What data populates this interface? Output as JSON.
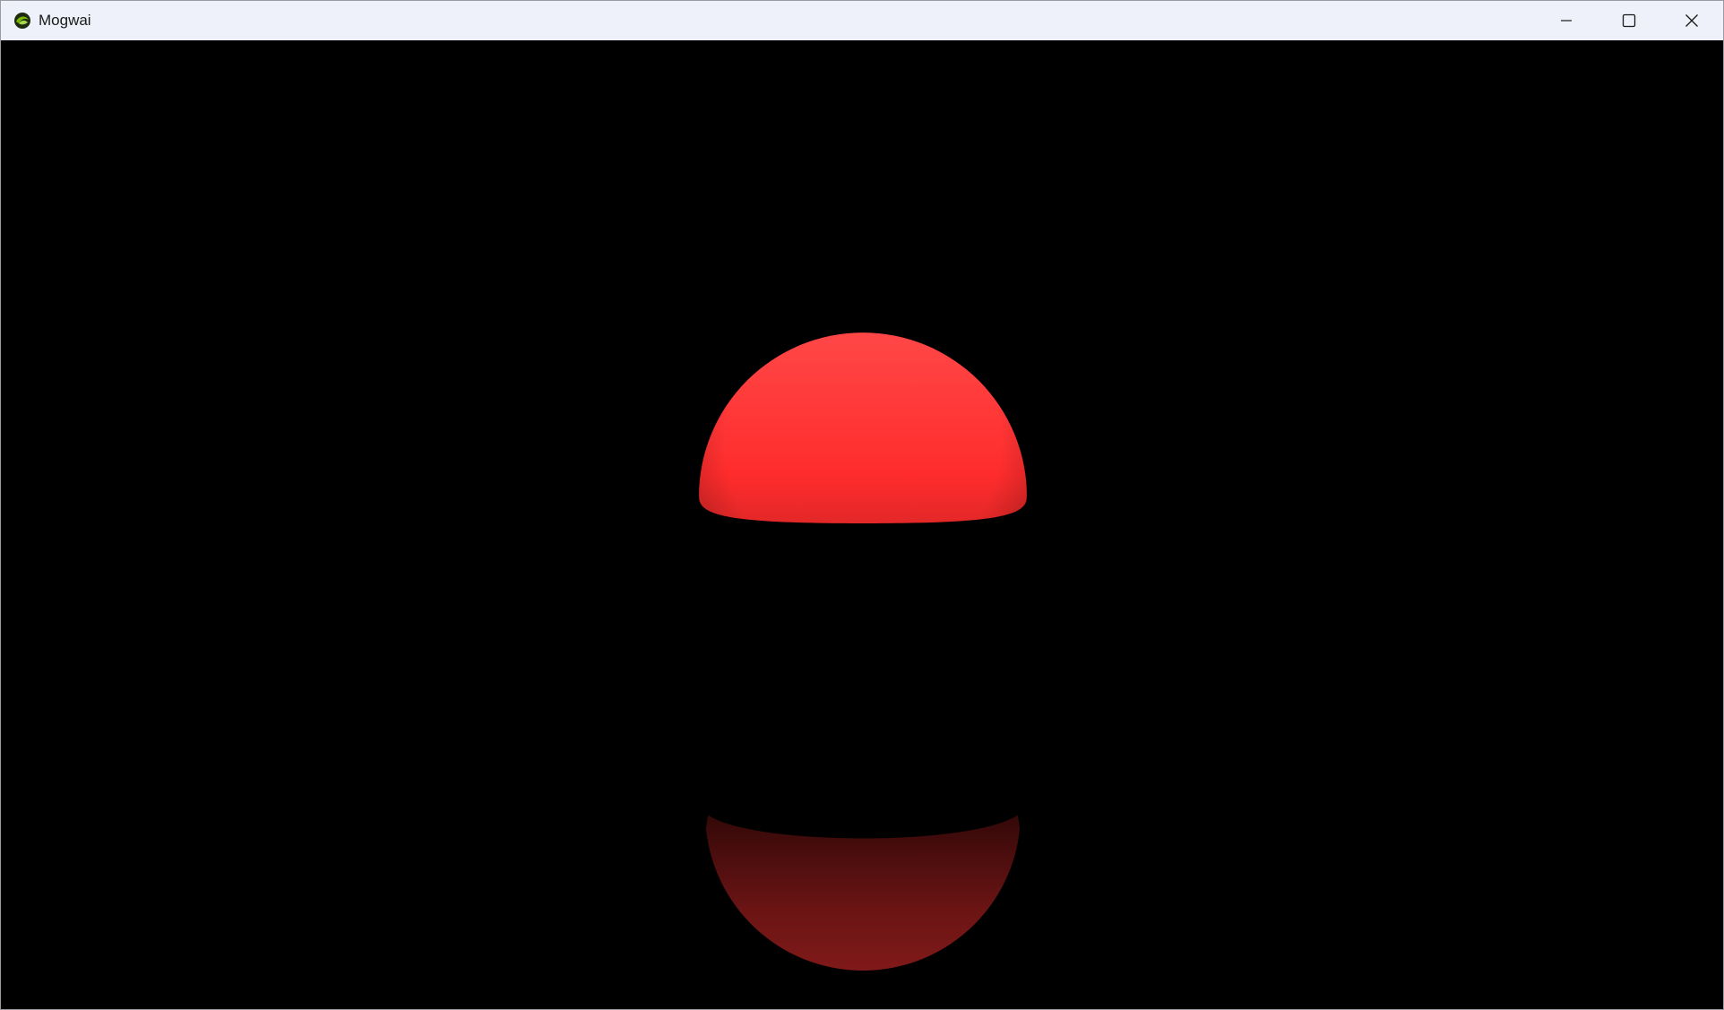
{
  "window": {
    "title": "Mogwai",
    "app_icon": "mogwai-logo-icon",
    "controls": [
      {
        "name": "minimize-button",
        "icon": "minimize-icon"
      },
      {
        "name": "maximize-button",
        "icon": "maximize-icon"
      },
      {
        "name": "close-button",
        "icon": "close-icon"
      }
    ]
  },
  "scene": {
    "background": "#000000",
    "objects": [
      {
        "name": "red-sphere",
        "color": "#ff2a2a"
      },
      {
        "name": "red-sphere-reflection",
        "color": "#7a1414"
      }
    ]
  }
}
